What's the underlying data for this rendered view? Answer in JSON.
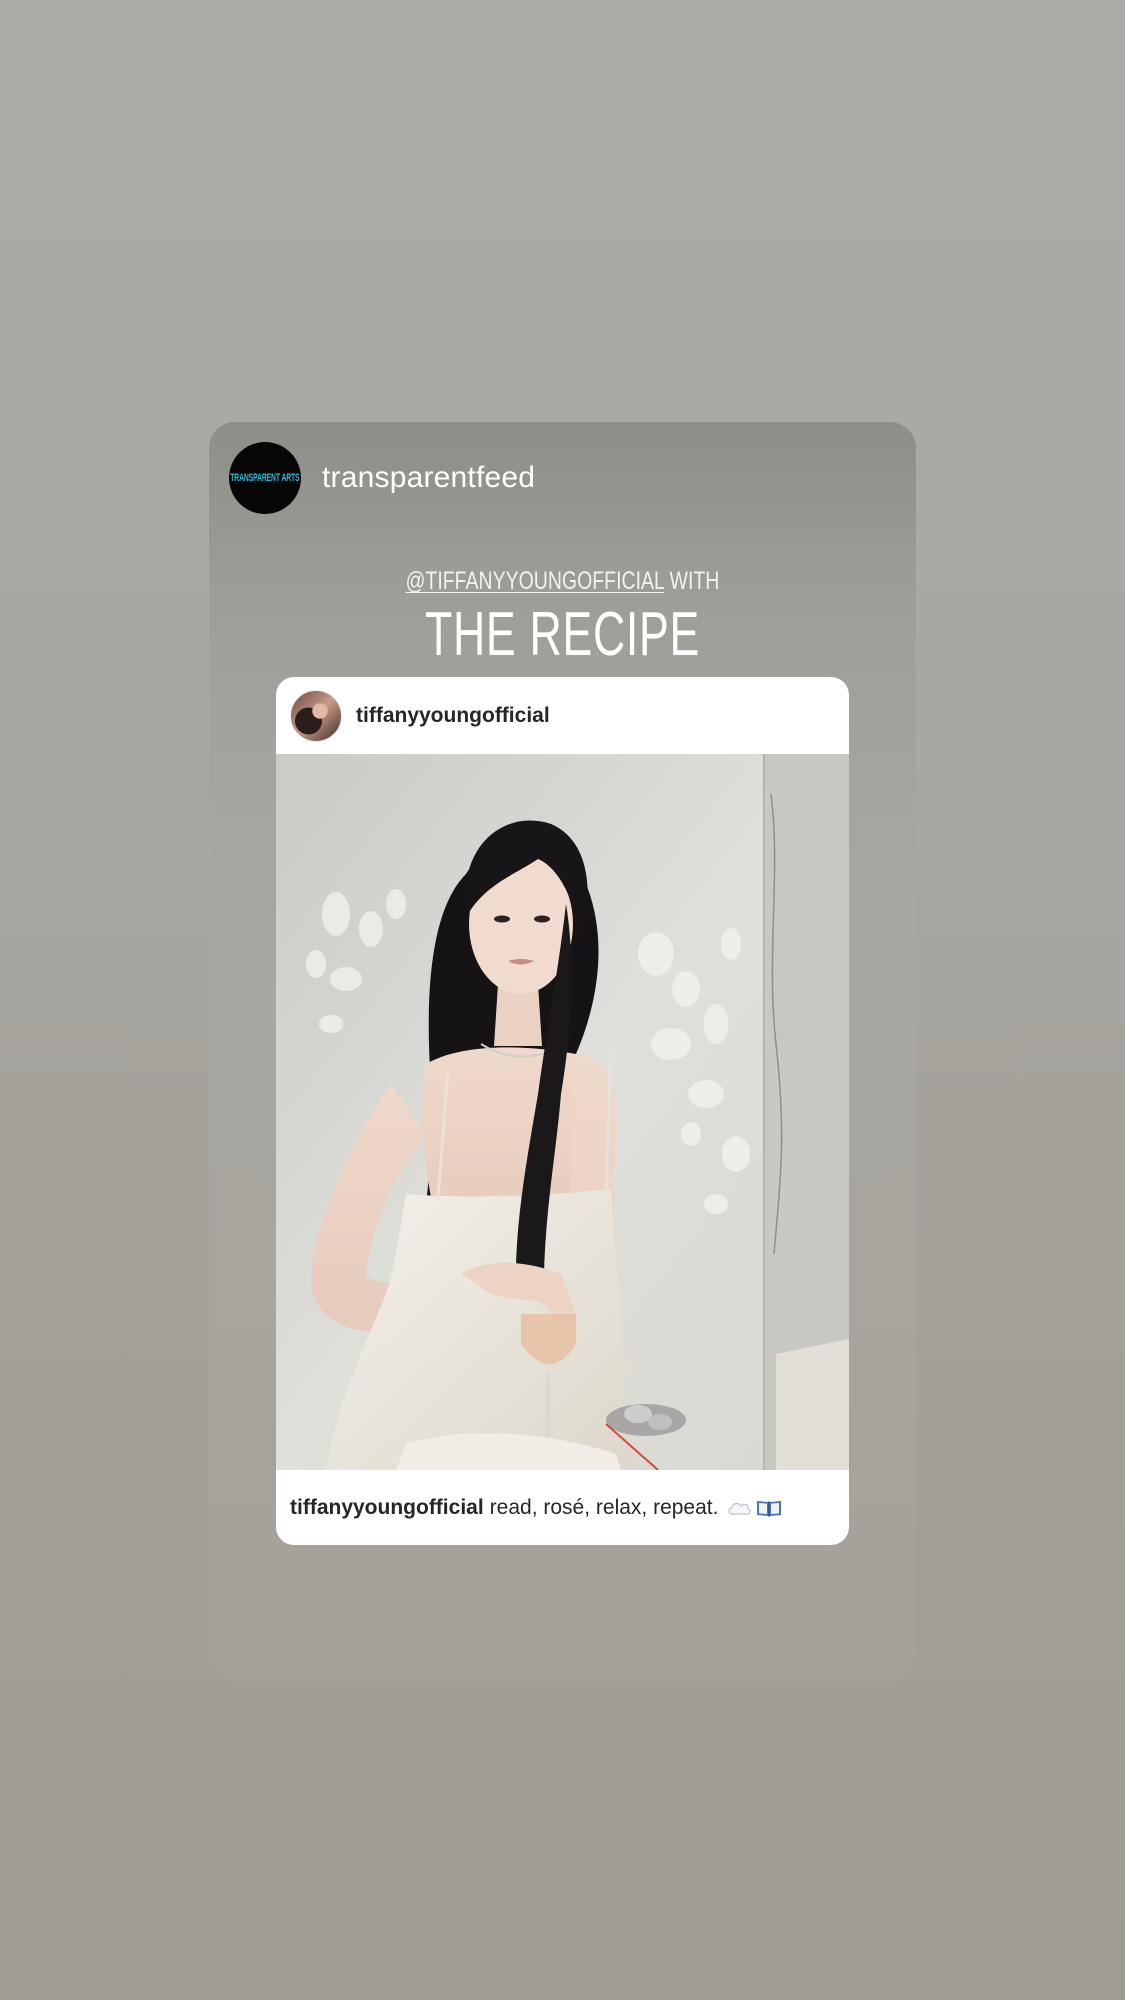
{
  "story": {
    "author_username": "transparentfeed",
    "author_avatar_text": "TRANSPARENT ARTS",
    "subtitle_mention": "@TIFFANYYOUNGOFFICIAL",
    "subtitle_suffix": "WITH",
    "title": "THE RECIPE"
  },
  "post": {
    "username": "tiffanyyoungofficial",
    "caption_username": "tiffanyyoungofficial",
    "caption_text": "read, rosé, relax, repeat.",
    "caption_icons": [
      "cloud-icon",
      "open-book-icon"
    ]
  },
  "colors": {
    "background": "#a8a8a2",
    "brand_accent": "#34b9d6",
    "post_text": "#262626"
  }
}
